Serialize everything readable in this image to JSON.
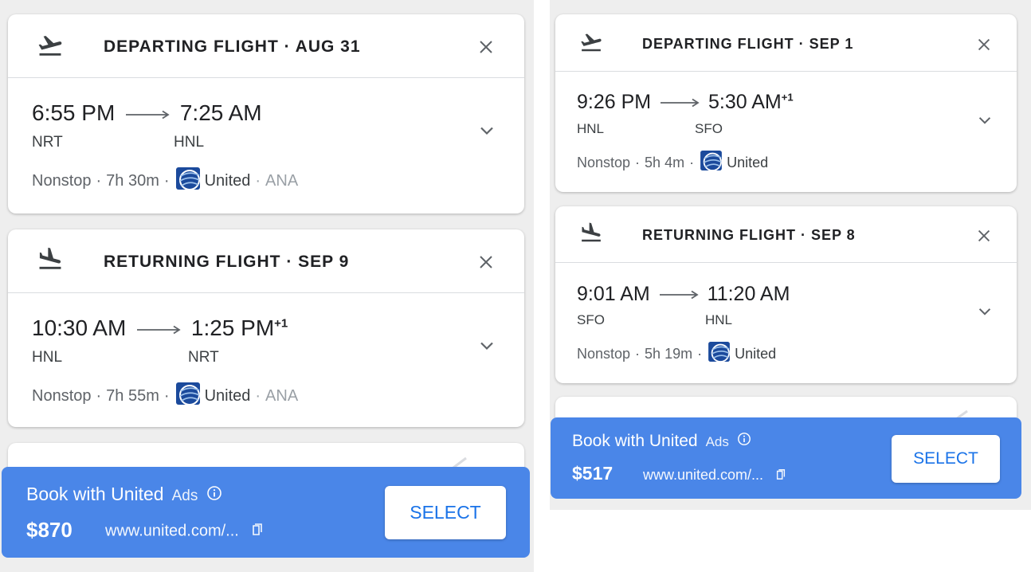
{
  "left": {
    "departing": {
      "title": "DEPARTING FLIGHT · AUG 31",
      "dep_time": "6:55 PM",
      "arr_time": "7:25 AM",
      "arr_dayoff": "",
      "origin": "NRT",
      "destination": "HNL",
      "stops": "Nonstop",
      "duration": "7h 30m",
      "airline": "United",
      "partner": "ANA"
    },
    "returning": {
      "title": "RETURNING FLIGHT · SEP 9",
      "dep_time": "10:30 AM",
      "arr_time": "1:25 PM",
      "arr_dayoff": "+1",
      "origin": "HNL",
      "destination": "NRT",
      "stops": "Nonstop",
      "duration": "7h 55m",
      "airline": "United",
      "partner": "ANA"
    },
    "banner": {
      "title": "Book with United",
      "ads": "Ads",
      "price": "$870",
      "url": "www.united.com/...",
      "select": "SELECT"
    }
  },
  "right": {
    "departing": {
      "title": "DEPARTING FLIGHT · SEP 1",
      "dep_time": "9:26 PM",
      "arr_time": "5:30 AM",
      "arr_dayoff": "+1",
      "origin": "HNL",
      "destination": "SFO",
      "stops": "Nonstop",
      "duration": "5h 4m",
      "airline": "United"
    },
    "returning": {
      "title": "RETURNING FLIGHT · SEP 8",
      "dep_time": "9:01 AM",
      "arr_time": "11:20 AM",
      "arr_dayoff": "",
      "origin": "SFO",
      "destination": "HNL",
      "stops": "Nonstop",
      "duration": "5h 19m",
      "airline": "United"
    },
    "banner": {
      "title": "Book with United",
      "ads": "Ads",
      "price": "$517",
      "url": "www.united.com/...",
      "select": "SELECT"
    }
  },
  "icons": {
    "takeoff": "flight-takeoff-icon",
    "landing": "flight-landing-icon",
    "close": "close-icon",
    "expand": "chevron-down-icon",
    "info": "info-icon",
    "copy": "copy-link-icon",
    "airline_logo": "united-globe-logo"
  },
  "colors": {
    "banner": "#4a86e8",
    "select_text": "#1a73e8",
    "united_logo": "#1b4a9c"
  }
}
